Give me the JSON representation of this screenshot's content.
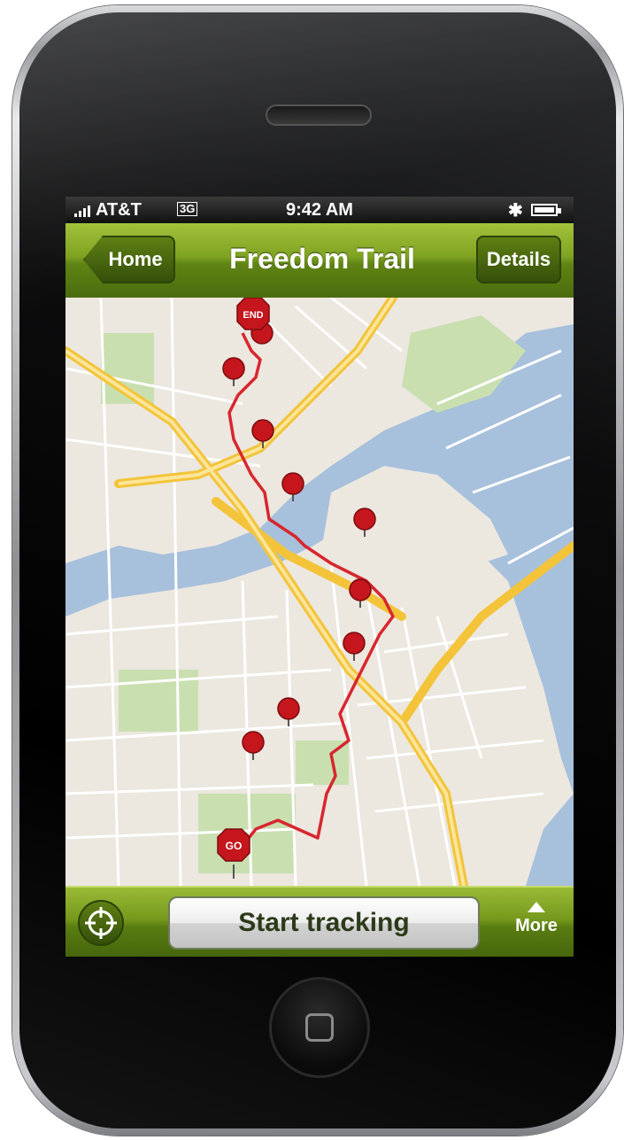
{
  "status_bar": {
    "carrier": "AT&T",
    "network": "3G",
    "time": "9:42 AM",
    "bluetooth_icon": "bluetooth-icon",
    "battery_icon": "battery-icon"
  },
  "nav_bar": {
    "back_label": "Home",
    "title": "Freedom Trail",
    "right_label": "Details"
  },
  "map": {
    "start_pin_label": "GO",
    "end_pin_label": "END",
    "pin_count": 11,
    "route_color": "#d8262e",
    "water_color": "#a7c0dc",
    "park_color": "#c9dfb0",
    "highway_color": "#f3c43a"
  },
  "toolbar": {
    "locate_icon": "crosshair-icon",
    "start_label": "Start tracking",
    "more_label": "More"
  },
  "colors": {
    "bar_green": "#6e9419",
    "button_text": "#2c3a1a"
  }
}
